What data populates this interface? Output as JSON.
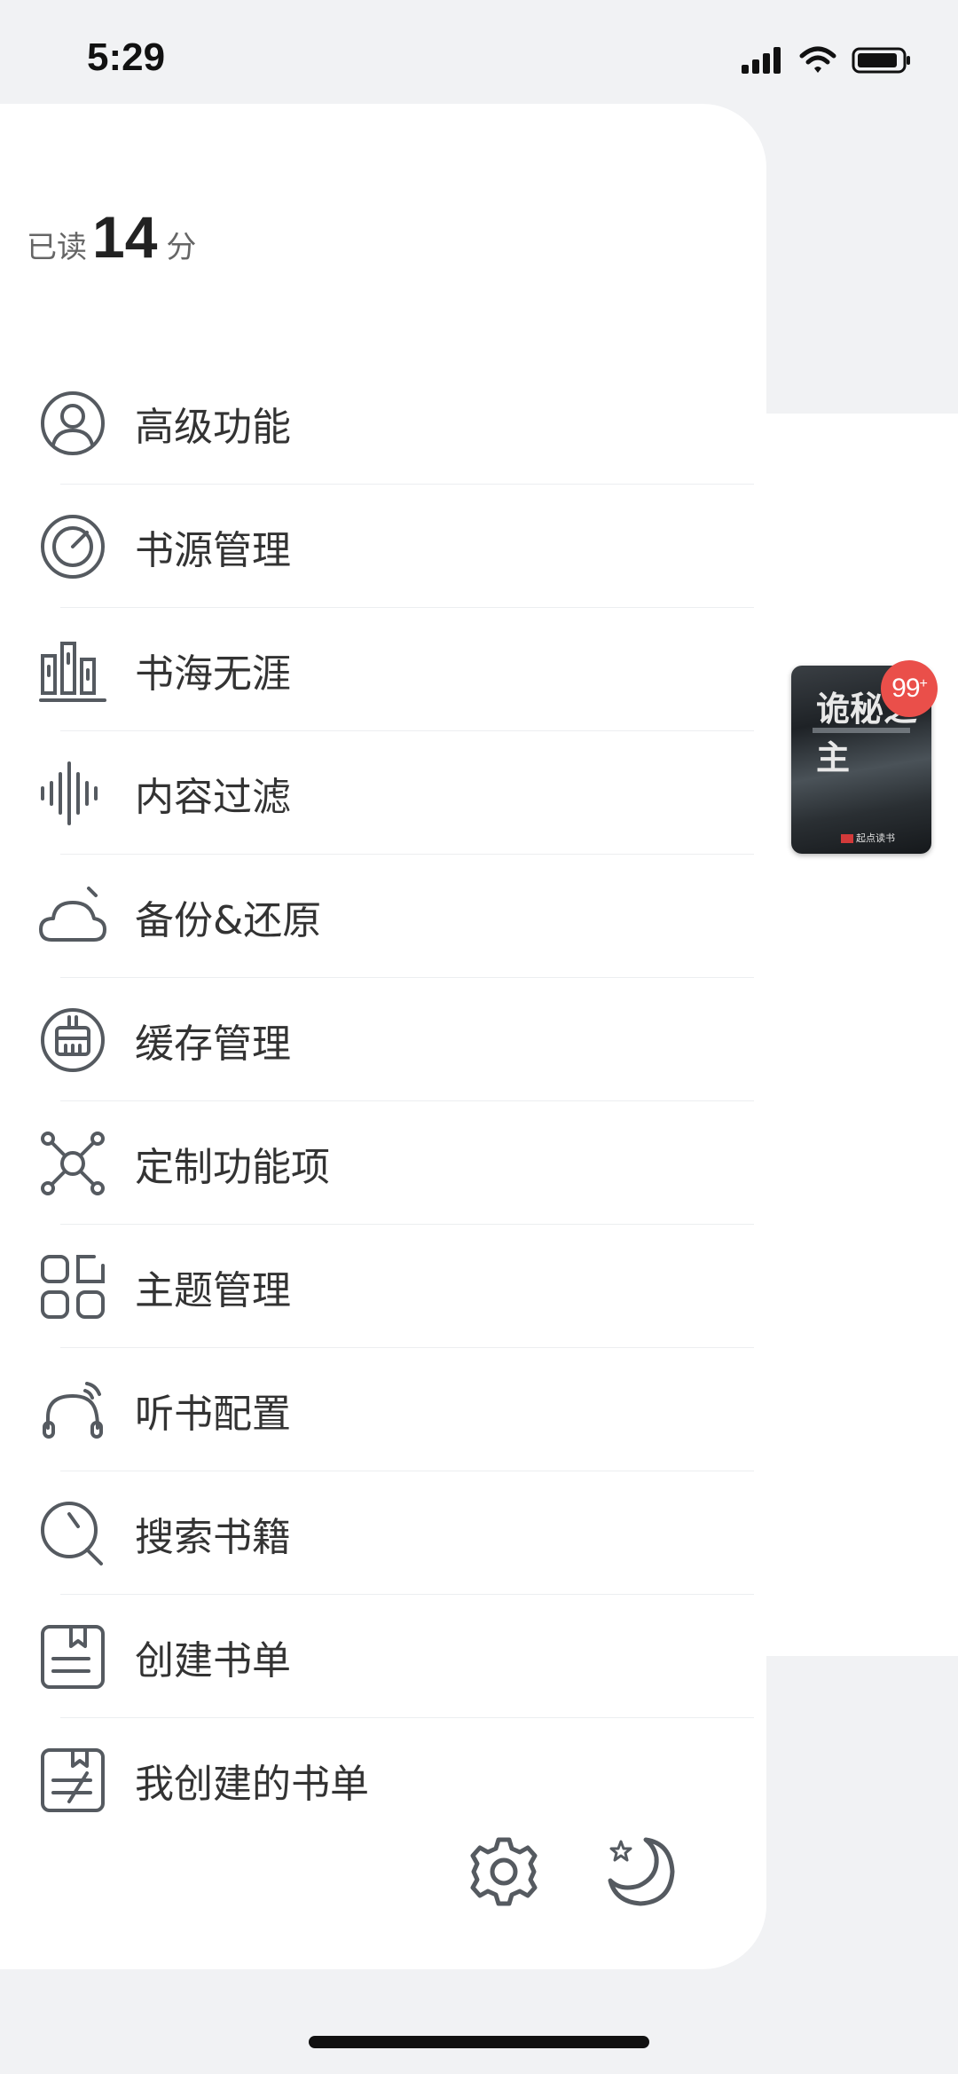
{
  "status_bar": {
    "time": "5:29"
  },
  "drawer": {
    "score": {
      "prefix": "已读",
      "value": "14",
      "suffix": "分"
    },
    "menu": [
      {
        "label": "高级功能",
        "icon": "user-circle-icon"
      },
      {
        "label": "书源管理",
        "icon": "disc-icon"
      },
      {
        "label": "书海无涯",
        "icon": "bookshelf-icon"
      },
      {
        "label": "内容过滤",
        "icon": "sound-wave-icon"
      },
      {
        "label": "备份&还原",
        "icon": "cloud-icon"
      },
      {
        "label": "缓存管理",
        "icon": "broom-icon"
      },
      {
        "label": "定制功能项",
        "icon": "network-icon"
      },
      {
        "label": "主题管理",
        "icon": "grid-icon"
      },
      {
        "label": "听书配置",
        "icon": "headphones-icon"
      },
      {
        "label": "搜索书籍",
        "icon": "search-icon"
      },
      {
        "label": "创建书单",
        "icon": "booklist-icon"
      },
      {
        "label": "我创建的书单",
        "icon": "my-booklist-icon"
      }
    ],
    "bottom": {
      "settings_icon": "gear-icon",
      "night_mode_icon": "moon-star-icon"
    }
  },
  "background": {
    "book": {
      "title": "诡秘之主",
      "publisher": "起点读书",
      "badge": "99",
      "badge_plus": "+"
    }
  },
  "colors": {
    "icon_stroke": "#555a60",
    "badge": "#ea4f4a",
    "background": "#f1f2f4"
  }
}
